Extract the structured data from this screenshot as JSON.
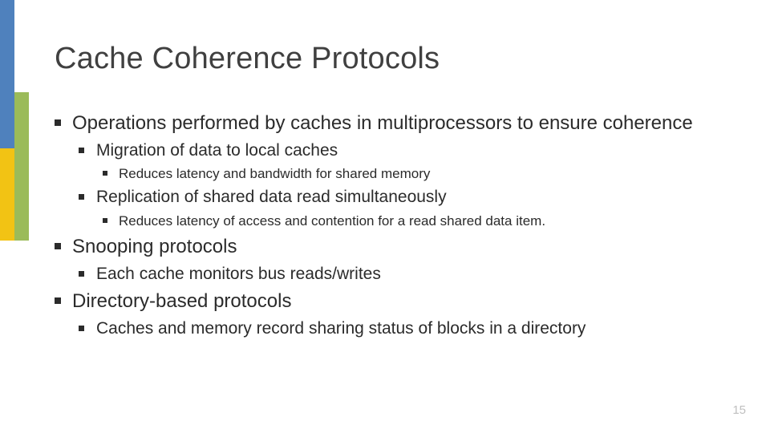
{
  "title": "Cache Coherence Protocols",
  "bullets": {
    "b1": "Operations performed by caches in multiprocessors to ensure coherence",
    "b1_1": "Migration of data to local caches",
    "b1_1_1": "Reduces latency and bandwidth for shared memory",
    "b1_2": "Replication of shared data read simultaneously",
    "b1_2_1": "Reduces latency of access and contention for a read shared data item.",
    "b2": "Snooping protocols",
    "b2_1": "Each cache monitors bus reads/writes",
    "b3": "Directory-based protocols",
    "b3_1": "Caches and memory record sharing status of blocks in a directory"
  },
  "page_number": "15"
}
